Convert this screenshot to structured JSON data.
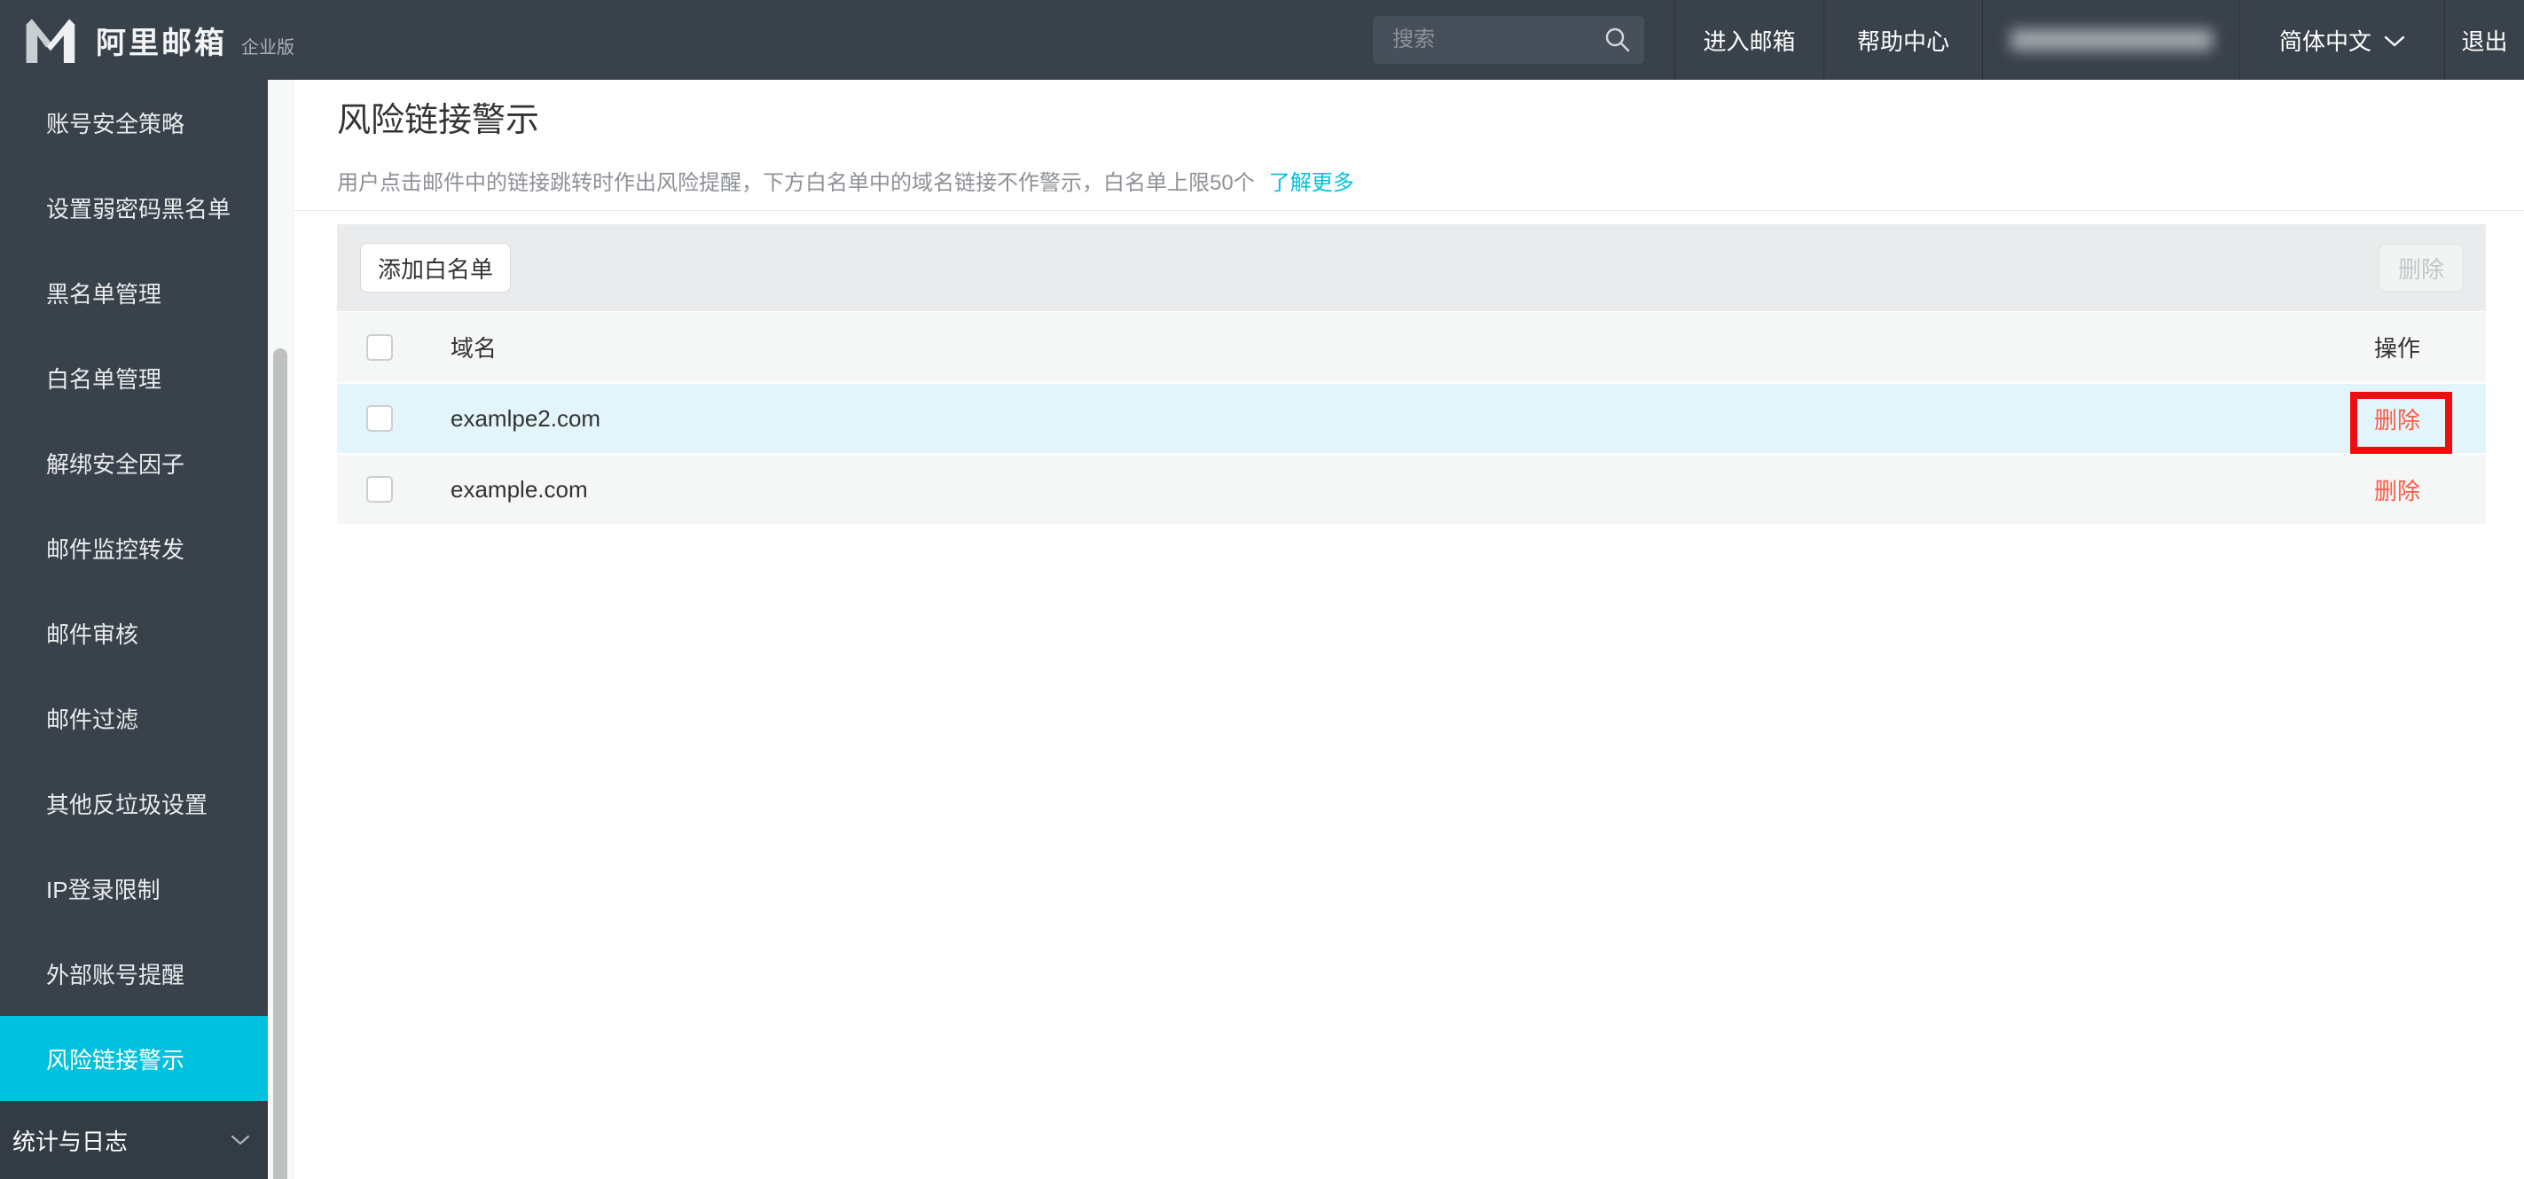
{
  "header": {
    "brand": {
      "title": "阿里邮箱",
      "edition": "企业版"
    },
    "search": {
      "placeholder": "搜索"
    },
    "menu": {
      "enter_mailbox": "进入邮箱",
      "help_center": "帮助中心",
      "language": "简体中文",
      "logout": "退出"
    }
  },
  "sidebar": {
    "items": [
      "账号安全策略",
      "设置弱密码黑名单",
      "黑名单管理",
      "白名单管理",
      "解绑安全因子",
      "邮件监控转发",
      "邮件审核",
      "邮件过滤",
      "其他反垃圾设置",
      "IP登录限制",
      "外部账号提醒",
      "风险链接警示"
    ],
    "active_item": "风险链接警示",
    "group_label": "统计与日志"
  },
  "page": {
    "title": "风险链接警示",
    "description": "用户点击邮件中的链接跳转时作出风险提醒，下方白名单中的域名链接不作警示，白名单上限50个",
    "learn_more": "了解更多"
  },
  "toolbar": {
    "add_whitelist": "添加白名单",
    "delete": "删除"
  },
  "table": {
    "header": {
      "domain": "域名",
      "action": "操作"
    },
    "rows": [
      {
        "domain": "examlpe2.com",
        "action": "删除"
      },
      {
        "domain": "example.com",
        "action": "删除"
      }
    ]
  },
  "colors": {
    "accent": "#00c1de",
    "danger": "#ff5945",
    "annotation_box": "#ee0e0e",
    "header_bg": "#39414a"
  }
}
